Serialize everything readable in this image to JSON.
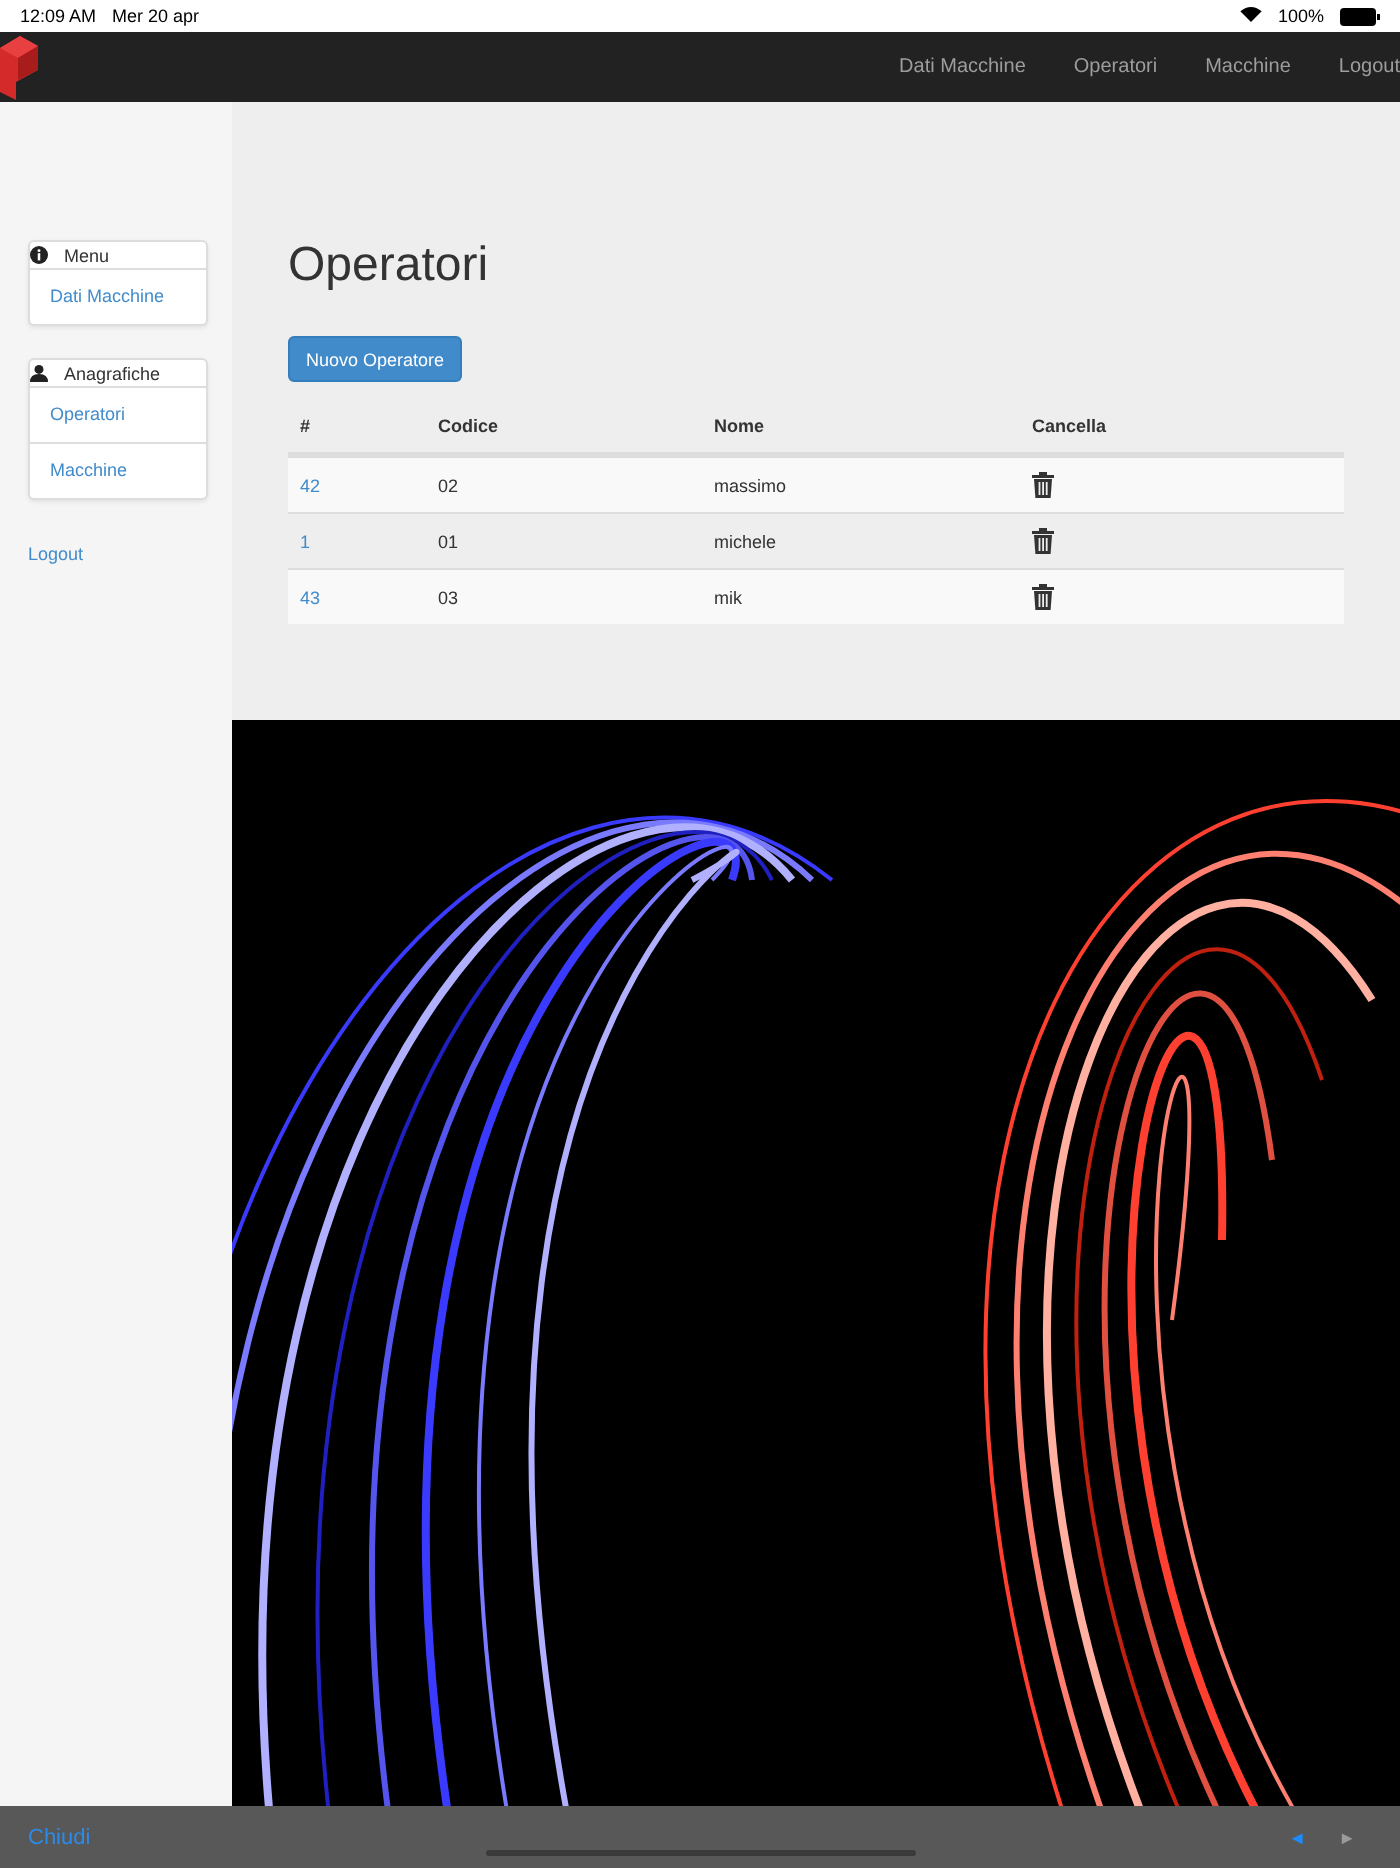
{
  "status_bar": {
    "time": "12:09 AM",
    "date": "Mer 20 apr",
    "battery": "100%"
  },
  "navbar": {
    "links": [
      "Dati Macchine",
      "Operatori",
      "Macchine",
      "Logout"
    ]
  },
  "sidebar": {
    "panels": [
      {
        "title": "Menu",
        "kind": "info",
        "items": [
          "Dati Macchine"
        ]
      },
      {
        "title": "Anagrafiche",
        "kind": "user",
        "items": [
          "Operatori",
          "Macchine"
        ]
      }
    ],
    "logout": "Logout"
  },
  "page": {
    "title": "Operatori",
    "new_button": "Nuovo Operatore"
  },
  "table": {
    "columns": [
      "#",
      "Codice",
      "Nome",
      "Cancella"
    ],
    "rows": [
      {
        "id": "42",
        "code": "02",
        "name": "massimo"
      },
      {
        "id": "1",
        "code": "01",
        "name": "michele"
      },
      {
        "id": "43",
        "code": "03",
        "name": "mik"
      }
    ]
  },
  "toolbar": {
    "close": "Chiudi",
    "back": {
      "label": "◄",
      "disabled": false
    },
    "forward": {
      "label": "►",
      "disabled": true
    }
  }
}
